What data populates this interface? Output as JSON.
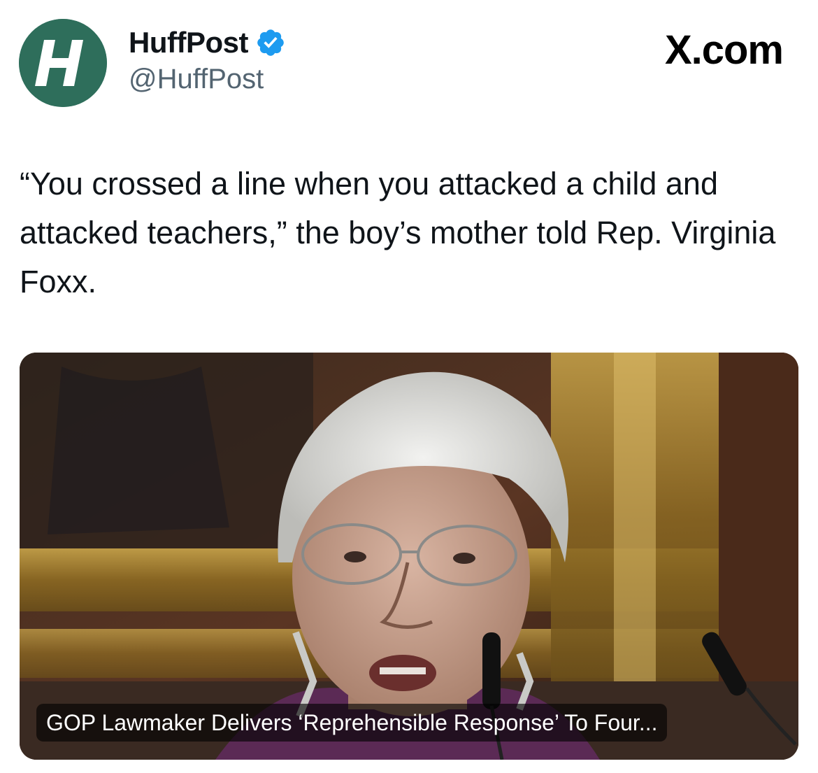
{
  "account": {
    "display_name": "HuffPost",
    "handle": "@HuffPost",
    "avatar_letter": "H",
    "avatar_color": "#2e6e5b",
    "verified": true,
    "verified_color": "#1d9bf0"
  },
  "watermark": "X.com",
  "tweet": {
    "text": "“You crossed a line when you attacked a child and attacked teachers,” the boy’s mother told Rep. Virginia Foxx."
  },
  "link_card": {
    "title": "GOP Lawmaker Delivers ‘Reprehensible Response’ To Four...",
    "image_icon": "photo-of-speaker-at-microphones"
  }
}
